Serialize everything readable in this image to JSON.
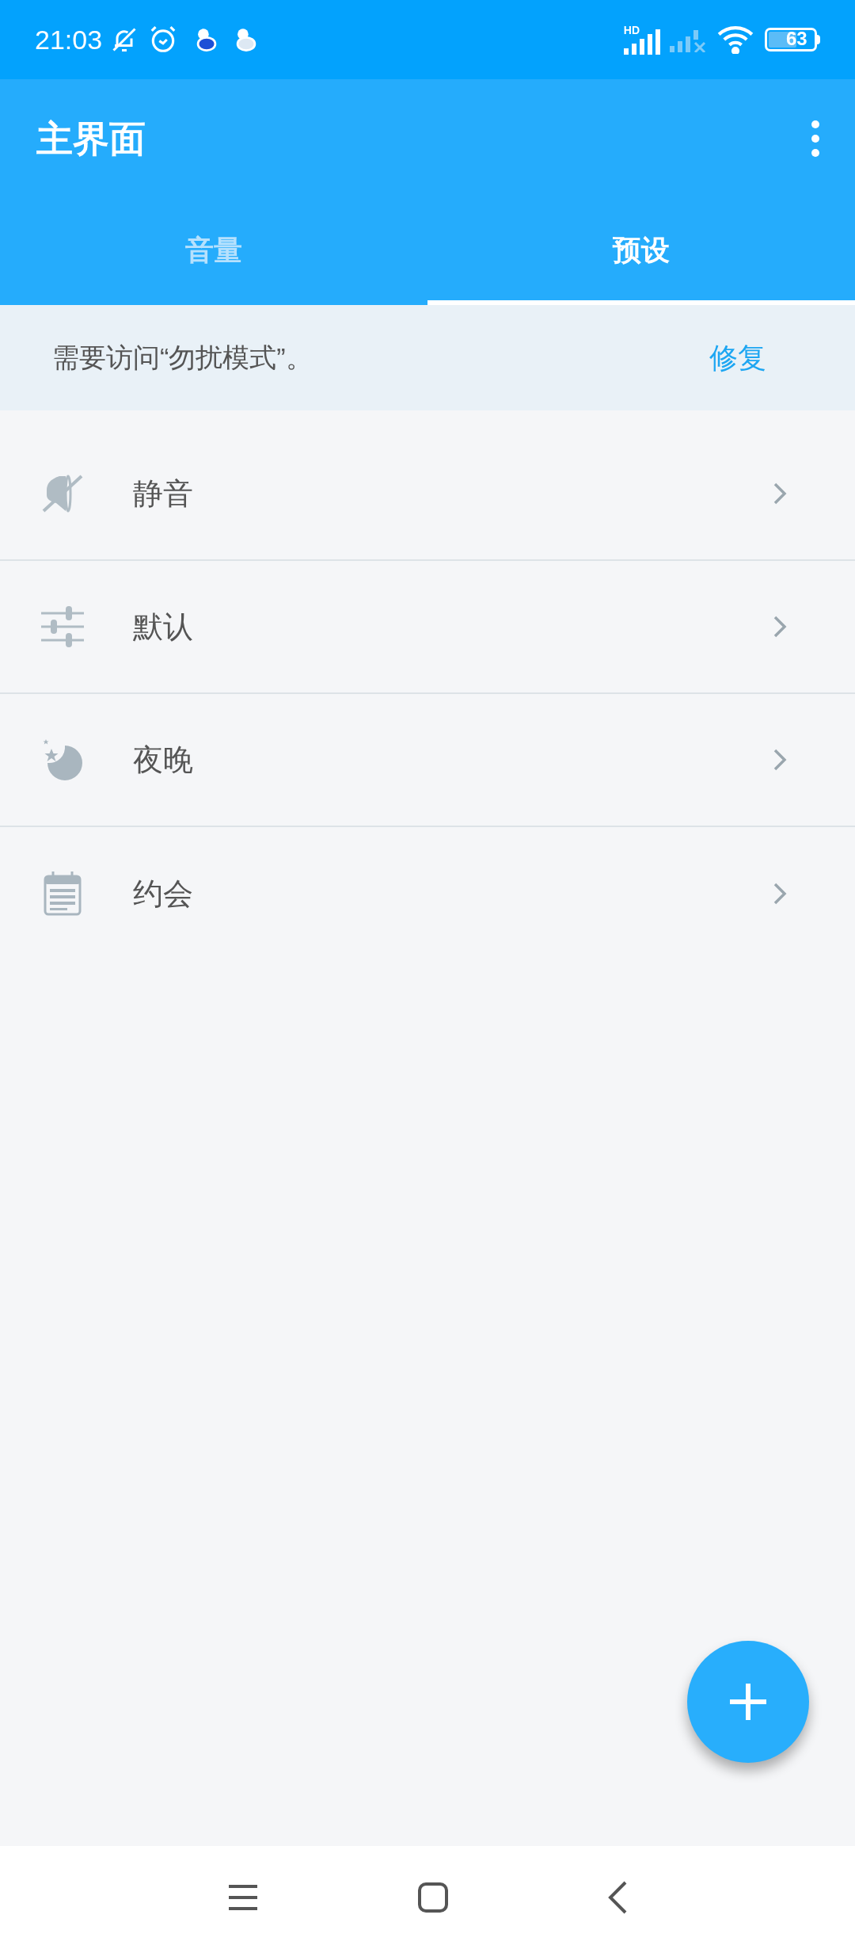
{
  "status_bar": {
    "time": "21:03",
    "network_label": "HD",
    "battery": "63"
  },
  "app_bar": {
    "title": "主界面"
  },
  "tabs": [
    {
      "label": "音量",
      "selected": false
    },
    {
      "label": "预设",
      "selected": true
    }
  ],
  "banner": {
    "message": "需要访问“勿扰模式”。",
    "action": "修复"
  },
  "presets": [
    {
      "label": "静音",
      "kind": "mute"
    },
    {
      "label": "默认",
      "kind": "sliders"
    },
    {
      "label": "夜晚",
      "kind": "night"
    },
    {
      "label": "约会",
      "kind": "calendar"
    }
  ]
}
